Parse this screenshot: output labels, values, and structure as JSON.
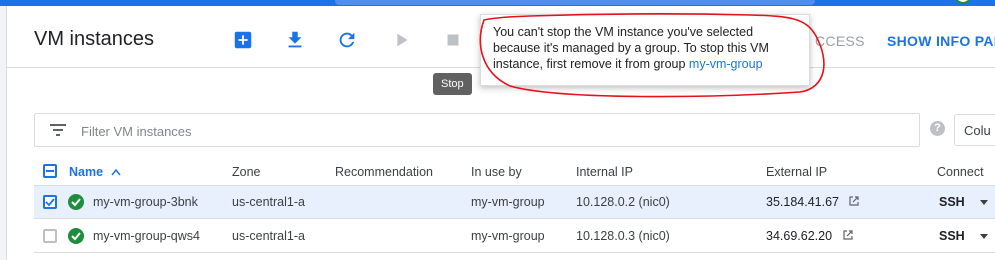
{
  "page": {
    "title": "VM instances"
  },
  "toolbar": {
    "create_icon": "add-box-icon",
    "import_icon": "download-icon",
    "refresh_icon": "refresh-icon",
    "start_icon": "play-icon",
    "stop_icon": "stop-icon",
    "tab_access": "CCESS",
    "tab_info": "SHOW INFO PAN"
  },
  "tooltip": {
    "stop": "Stop"
  },
  "popover": {
    "message": "You can't stop the VM instance you've selected because it's managed by a group. To stop this VM instance, first remove it from group ",
    "link": "my-vm-group",
    "annotation_color": "#e8101a"
  },
  "filter": {
    "placeholder": "Filter VM instances",
    "value": ""
  },
  "columns_button": "Colu",
  "table": {
    "headers": {
      "name": "Name",
      "zone": "Zone",
      "recommendation": "Recommendation",
      "in_use_by": "In use by",
      "internal_ip": "Internal IP",
      "external_ip": "External IP",
      "connect": "Connect"
    },
    "rows": [
      {
        "selected": true,
        "name": "my-vm-group-3bnk",
        "zone": "us-central1-a",
        "recommendation": "",
        "in_use_by": "my-vm-group",
        "internal_ip": "10.128.0.2 (nic0)",
        "external_ip": "35.184.41.67",
        "connect": "SSH",
        "status": "running"
      },
      {
        "selected": false,
        "name": "my-vm-group-qws4",
        "zone": "us-central1-a",
        "recommendation": "",
        "in_use_by": "my-vm-group",
        "internal_ip": "10.128.0.3 (nic0)",
        "external_ip": "34.69.62.20",
        "connect": "SSH",
        "status": "running"
      }
    ]
  },
  "colors": {
    "accent": "#1a73e8",
    "status_ok": "#1e8e3e",
    "selected_row": "#e8f0fe"
  }
}
